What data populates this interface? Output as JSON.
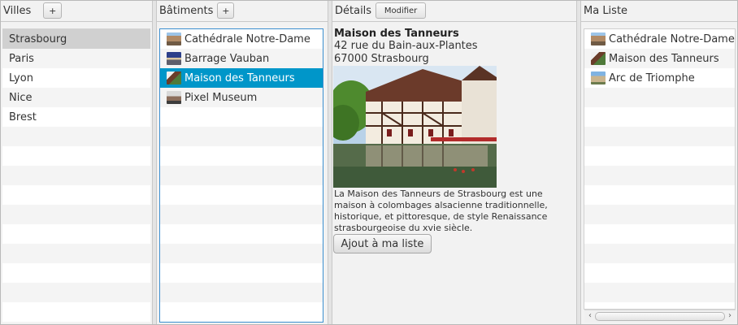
{
  "villes": {
    "title": "Villes",
    "add_label": "+",
    "items": [
      "Strasbourg",
      "Paris",
      "Lyon",
      "Nice",
      "Brest"
    ],
    "selected": "Strasbourg"
  },
  "batiments": {
    "title": "Bâtiments",
    "add_label": "+",
    "items": [
      {
        "label": "Cathédrale Notre-Dame",
        "icon": "cathedral-thumbnail"
      },
      {
        "label": "Barrage Vauban",
        "icon": "dam-thumbnail"
      },
      {
        "label": "Maison des Tanneurs",
        "icon": "tanneurs-thumbnail"
      },
      {
        "label": "Pixel Museum",
        "icon": "museum-thumbnail"
      }
    ],
    "selected": "Maison des Tanneurs"
  },
  "details": {
    "title": "Détails",
    "modify_label": "Modifier",
    "name": "Maison des Tanneurs",
    "address_line1": "42 rue du Bain-aux-Plantes",
    "address_line2": "67000 Strasbourg",
    "photo_icon": "half-timbered-house-photo",
    "description_lines": [
      "La Maison des Tanneurs de Strasbourg est une",
      "maison à colombages alsacienne traditionnelle,",
      "historique, et pittoresque, de style Renaissance",
      "strasbourgeoise du xvie siècle."
    ],
    "add_button_label": "Ajout à ma liste"
  },
  "ma_liste": {
    "title": "Ma Liste",
    "items": [
      {
        "label": "Cathédrale Notre-Dame",
        "icon": "cathedral-thumbnail"
      },
      {
        "label": "Maison des Tanneurs",
        "icon": "tanneurs-thumbnail"
      },
      {
        "label": "Arc de Triomphe",
        "icon": "arc-thumbnail"
      }
    ]
  },
  "colors": {
    "selection_blue": "#0096c9",
    "selection_grey": "#d0d0d0",
    "border_blue": "#3c8fd0"
  }
}
